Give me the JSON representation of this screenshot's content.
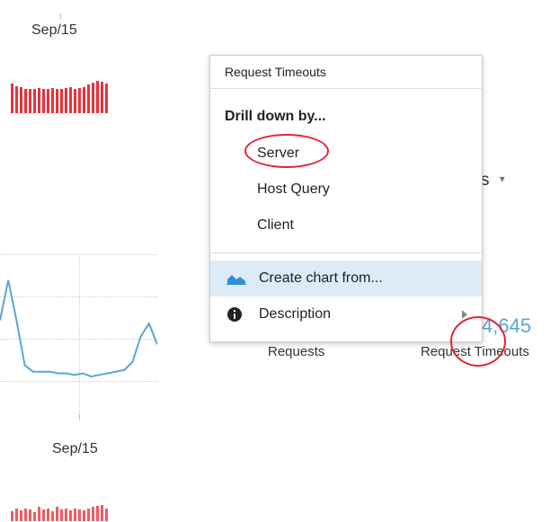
{
  "charts": {
    "top_date": "Sep/15",
    "bottom_date": "Sep/15",
    "top_bars": [
      34,
      31,
      30,
      28,
      28,
      28,
      29,
      28,
      28,
      29,
      28,
      28,
      29,
      30,
      28,
      29,
      30,
      33,
      35,
      37,
      36,
      34
    ],
    "bottom_bars": [
      9,
      12,
      10,
      12,
      11,
      8,
      13,
      11,
      12,
      9,
      13,
      11,
      12,
      10,
      12,
      11,
      10,
      12,
      13,
      14,
      15,
      12
    ],
    "line_series": [
      40,
      65,
      40,
      12,
      8,
      8,
      8,
      7,
      7,
      6,
      7,
      5,
      6,
      7,
      8,
      9,
      14,
      30,
      38,
      25
    ],
    "colors": {
      "bar": "#e8323c",
      "line": "#5aa6d1"
    }
  },
  "menu": {
    "title": "Request Timeouts",
    "section_label": "Drill down by...",
    "items": [
      "Server",
      "Host Query",
      "Client"
    ],
    "create_chart": "Create chart from...",
    "description": "Description"
  },
  "partial_header": {
    "text": "s",
    "caret": "▾"
  },
  "stats": {
    "requests_label": "Requests",
    "timeouts_value": "4,645",
    "timeouts_label": "Request Timeouts"
  },
  "icons": {
    "chart": "area-chart-icon",
    "info": "info-circle-icon",
    "submenu": "chevron-right-icon"
  }
}
